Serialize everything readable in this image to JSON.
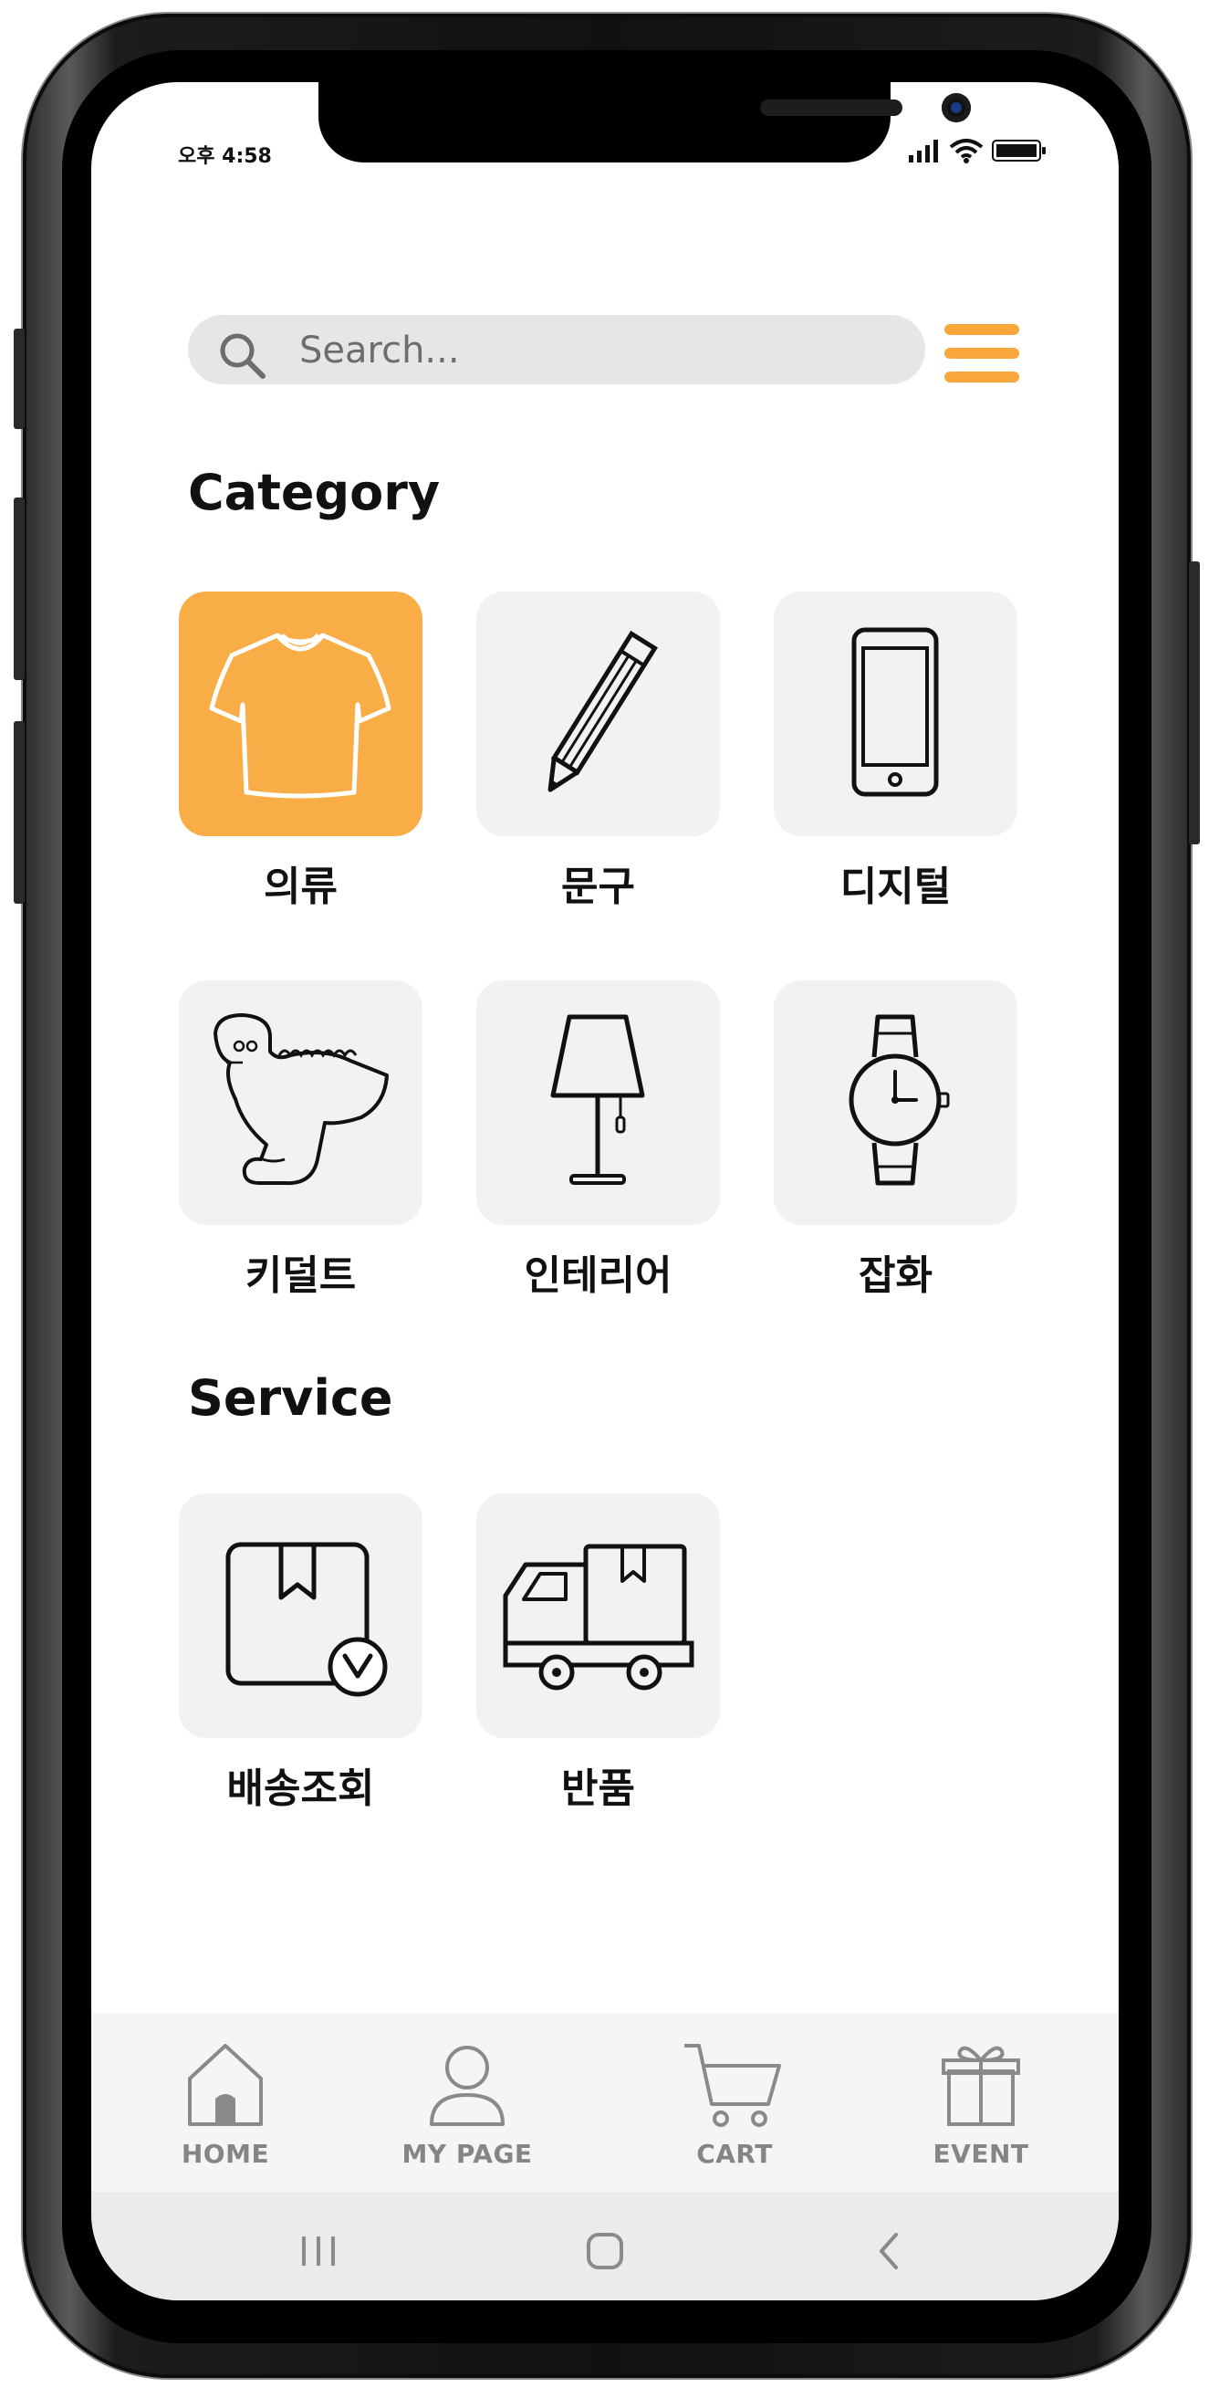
{
  "status_bar": {
    "time": "오후 4:58"
  },
  "search": {
    "placeholder": "Search..."
  },
  "sections": {
    "category_title": "Category",
    "service_title": "Service"
  },
  "categories": [
    {
      "label": "의류",
      "icon": "tshirt-icon",
      "selected": true
    },
    {
      "label": "문구",
      "icon": "pencil-icon",
      "selected": false
    },
    {
      "label": "디지털",
      "icon": "smartphone-icon",
      "selected": false
    },
    {
      "label": "키덜트",
      "icon": "dinosaur-icon",
      "selected": false
    },
    {
      "label": "인테리어",
      "icon": "lamp-icon",
      "selected": false
    },
    {
      "label": "잡화",
      "icon": "wristwatch-icon",
      "selected": false
    }
  ],
  "services": [
    {
      "label": "배송조회",
      "icon": "package-check-icon"
    },
    {
      "label": "반품",
      "icon": "delivery-truck-icon"
    }
  ],
  "bottom_nav": [
    {
      "label": "HOME",
      "icon": "home-icon"
    },
    {
      "label": "MY PAGE",
      "icon": "user-icon"
    },
    {
      "label": "CART",
      "icon": "cart-icon"
    },
    {
      "label": "EVENT",
      "icon": "gift-icon"
    }
  ],
  "system_nav": [
    "recent-apps-icon",
    "home-circle-icon",
    "back-icon"
  ],
  "colors": {
    "accent": "#f9ad46",
    "menu": "#f9a73a",
    "tile_background": "#f2f2f2",
    "search_background": "#e6e6e6",
    "nav_text": "#858585"
  }
}
